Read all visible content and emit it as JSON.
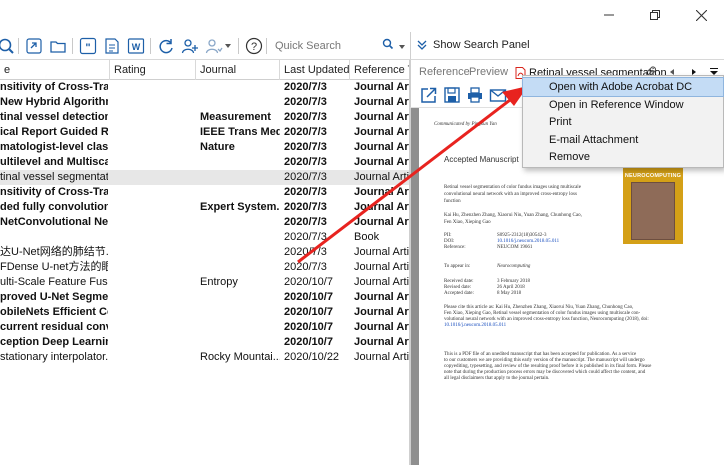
{
  "toolbar": {
    "search": {
      "placeholder": "Quick Search"
    },
    "icons": [
      "search-icon",
      "link-icon",
      "folder-icon",
      "quote-icon",
      "word-icon",
      "word-icon-2",
      "sync-icon",
      "share-icon",
      "group-share-icon",
      "help-icon"
    ]
  },
  "right_panel": {
    "show_search_label": "Show Search Panel",
    "tabs": [
      {
        "label": "Reference"
      },
      {
        "label": "Preview"
      },
      {
        "label": "Retinal vessel segmentation"
      }
    ]
  },
  "table": {
    "columns": [
      {
        "label": "e"
      },
      {
        "label": "Rating"
      },
      {
        "label": "Journal"
      },
      {
        "label": "Last Updated"
      },
      {
        "label": "Reference Ty"
      }
    ],
    "rows": [
      {
        "title": "nsitivity of Cross-Trai...",
        "journal": "",
        "updated": "2020/7/3",
        "type": "Journal Artic",
        "bold": true
      },
      {
        "title": "New Hybrid Algorithm...",
        "journal": "",
        "updated": "2020/7/3",
        "type": "Journal Artic",
        "bold": true
      },
      {
        "title": "tinal vessel detection ...",
        "journal": "Measurement",
        "updated": "2020/7/3",
        "type": "Journal Artic",
        "bold": true
      },
      {
        "title": "ical Report Guided Re...",
        "journal": "IEEE Trans Med ...",
        "updated": "2020/7/3",
        "type": "Journal Artic",
        "bold": true
      },
      {
        "title": "matologist-level classi...",
        "journal": "Nature",
        "updated": "2020/7/3",
        "type": "Journal Artic",
        "bold": true
      },
      {
        "title": "ultilevel and Multiscal...",
        "journal": "",
        "updated": "2020/7/3",
        "type": "Journal Artic",
        "bold": true
      },
      {
        "title": "tinal vessel segmentati...",
        "journal": "",
        "updated": "2020/7/3",
        "type": "Journal Artic",
        "bold": false
      },
      {
        "title": "nsitivity of Cross-Trai...",
        "journal": "",
        "updated": "2020/7/3",
        "type": "Journal Artic",
        "bold": true
      },
      {
        "title": "ded fully convolutiona...",
        "journal": "Expert System...",
        "updated": "2020/7/3",
        "type": "Journal Artic",
        "bold": true
      },
      {
        "title": "NetConvolutional Net...",
        "journal": "",
        "updated": "2020/7/3",
        "type": "Journal Artic",
        "bold": true
      },
      {
        "title": "",
        "journal": "",
        "updated": "2020/7/3",
        "type": "Book",
        "bold": false
      },
      {
        "title": "达U-Net网络的肺结节...",
        "journal": "",
        "updated": "2020/7/3",
        "type": "Journal Artic",
        "bold": false
      },
      {
        "title": "FDense U-net方法的眼...",
        "journal": "",
        "updated": "2020/7/3",
        "type": "Journal Artic",
        "bold": false
      },
      {
        "title": "ulti-Scale Feature Fusio...",
        "journal": "Entropy",
        "updated": "2020/10/7",
        "type": "Journal Artic",
        "bold": false
      },
      {
        "title": "proved U-Net Segme...",
        "journal": "",
        "updated": "2020/10/7",
        "type": "Journal Artic",
        "bold": true
      },
      {
        "title": "obileNets Efficient Co...",
        "journal": "",
        "updated": "2020/10/7",
        "type": "Journal Artic",
        "bold": true
      },
      {
        "title": "current residual conv...",
        "journal": "",
        "updated": "2020/10/7",
        "type": "Journal Artic",
        "bold": true
      },
      {
        "title": "ception Deep Learning...",
        "journal": "",
        "updated": "2020/10/7",
        "type": "Journal Artic",
        "bold": true
      },
      {
        "title": "stationary interpolator...",
        "journal": "Rocky Mountai...",
        "updated": "2020/10/22",
        "type": "Journal Artic",
        "bold": false
      }
    ]
  },
  "context_menu": {
    "items": [
      {
        "label": "Open with Adobe Acrobat DC"
      },
      {
        "label": "Open in Reference Window"
      },
      {
        "label": "Print"
      },
      {
        "label": "E-mail Attachment"
      },
      {
        "label": "Remove"
      }
    ]
  },
  "pdf": {
    "communicated": "Communicated by Pingkun Yan",
    "accepted": "Accepted Manuscript",
    "title": "Retinal vessel segmentation of color fundus images using multiscale convolutional neural network with an improved cross-entropy loss function",
    "title_l1": "Retinal vessel segmentation of color fundus images using multiscale",
    "title_l2": "convolutional neural network with an improved cross-entropy loss",
    "title_l3": "function",
    "authors_l1": "Kai Hu, Zhenzhen Zhang, Xiaorui Niu, Yuan Zhang, Chunhong Cao,",
    "authors_l2": "Fen Xiao, Xieping Gao",
    "pii_label": "PII:",
    "pii": "S0925-2312(18)30542-3",
    "doi_label": "DOI:",
    "doi": "10.1016/j.neucom.2018.05.011",
    "ref_label": "Reference:",
    "ref": "NEUCOM 19661",
    "appear_label": "To appear in:",
    "appear": "Neurocomputing",
    "received_label": "Received date:",
    "received": "3 February 2018",
    "revised_label": "Revised date:",
    "revised": "26 April 2018",
    "accepted_label": "Accepted date:",
    "accepted_date": "8 May 2018",
    "cite_l1": "Please cite this article as: Kai Hu, Zhenzhen Zhang, Xiaorui Niu, Yuan Zhang, Chunhong Cao,",
    "cite_l2": "Fen Xiao, Xieping Gao, Retinal vessel segmentation of color fundus images using multiscale con-",
    "cite_l3": "volutional neural network with an improved cross-entropy loss function, Neurocomputing (2018), doi:",
    "cite_l4": "10.1016/j.neucom.2018.05.011",
    "note_l1": "This is a PDF file of an unedited manuscript that has been accepted for publication. As a service",
    "note_l2": "to our customers we are providing this early version of the manuscript. The manuscript will undergo",
    "note_l3": "copyediting, typesetting, and review of the resulting proof before it is published in its final form. Please",
    "note_l4": "note that during the production process errors may be discovered which could affect the content, and",
    "note_l5": "all legal disclaimers that apply to the journal pertain.",
    "cover_title": "NEUROCOMPUTING"
  },
  "colors": {
    "annotation_arrow": "#e8231f",
    "menu_highlight": "#c4dcf5",
    "pdf_icon": "#d9261c"
  }
}
